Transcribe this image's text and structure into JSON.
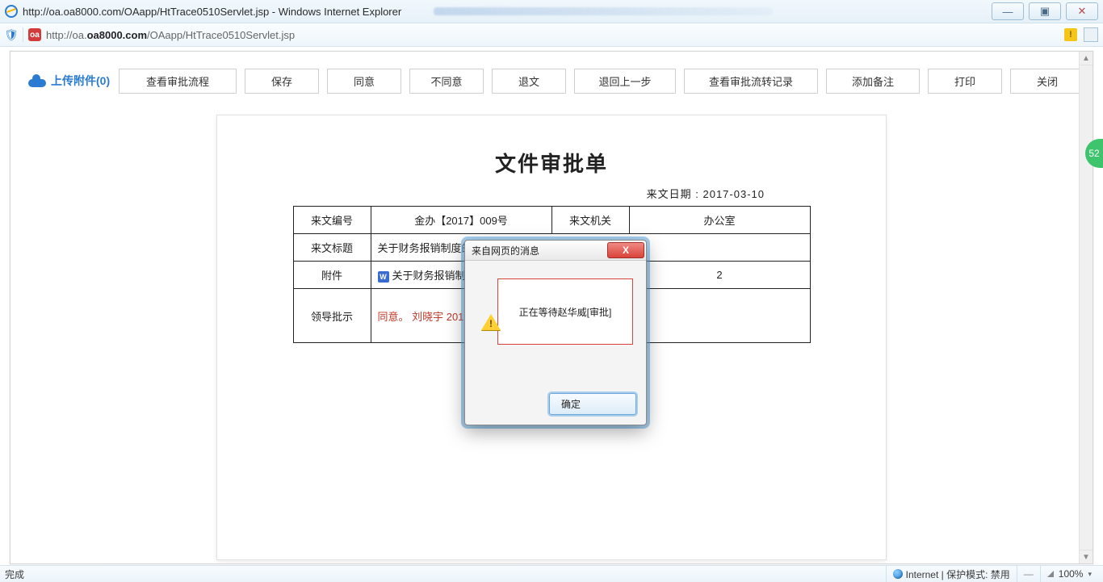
{
  "window": {
    "title": "http://oa.oa8000.com/OAapp/HtTrace0510Servlet.jsp - Windows Internet Explorer",
    "min": "—",
    "restore": "▣",
    "close": "✕"
  },
  "addr": {
    "shield": "🛡",
    "favicon": "oa",
    "url_prefix": "http://oa.",
    "url_bold": "oa8000.com",
    "url_suffix": "/OAapp/HtTrace0510Servlet.jsp",
    "warn": "!"
  },
  "toolbar": {
    "upload": "上传附件(0)",
    "view_flow": "查看审批流程",
    "save": "保存",
    "agree": "同意",
    "disagree": "不同意",
    "return_doc": "退文",
    "step_back": "退回上一步",
    "view_log": "查看审批流转记录",
    "add_note": "添加备注",
    "print": "打印",
    "close": "关闭"
  },
  "doc": {
    "title": "文件审批单",
    "received": "来文日期 : 2017-03-10",
    "rows": {
      "r1": {
        "c1": "来文编号",
        "c2": "金办【2017】009号",
        "c3": "来文机关",
        "c4": "办公室"
      },
      "r2": {
        "c1": "来文标题",
        "c2": "关于财务报销制度的规定"
      },
      "r3": {
        "c1": "附件",
        "c2": "关于财务报销制度",
        "c3": "",
        "c4": "2"
      },
      "r4": {
        "c1": "领导批示",
        "c2": "同意。 刘晓宇  2017"
      }
    }
  },
  "dialog": {
    "title": "来自网页的消息",
    "message": "正在等待赵华威[审批]",
    "ok": "确定",
    "close": "X"
  },
  "status": {
    "left": "完成",
    "zone": "Internet | 保护模式: 禁用",
    "dash": "—",
    "zoom": "100%",
    "chevron": "▾"
  },
  "side_badge": "52",
  "scroll": {
    "up": "▲",
    "down": "▼"
  }
}
